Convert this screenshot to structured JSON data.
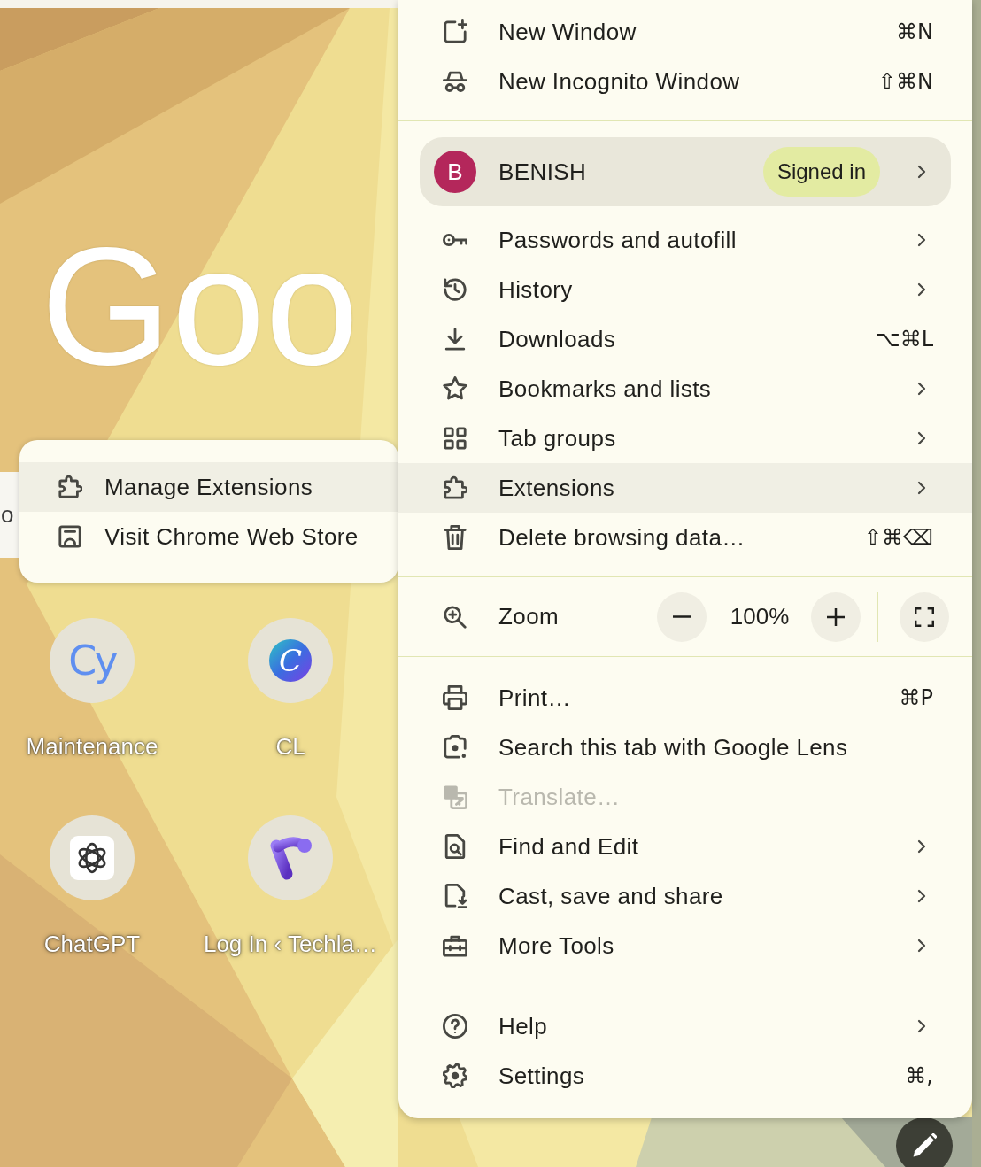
{
  "new_tab_page": {
    "logo_text": "Goo",
    "search_field": {
      "placeholder": "o"
    },
    "shortcuts": [
      {
        "kind": "letters",
        "icon_text": "Cy",
        "label": "Maintenance"
      },
      {
        "kind": "monogram",
        "icon_text": "C",
        "label": "CL"
      },
      {
        "kind": "knot",
        "label": "ChatGPT"
      },
      {
        "kind": "stroke",
        "label": "Log In ‹ Techla…"
      }
    ]
  },
  "extensions_submenu": {
    "items": [
      {
        "label": "Manage Extensions",
        "highlighted": true
      },
      {
        "label": "Visit Chrome Web Store",
        "highlighted": false
      }
    ]
  },
  "main_menu": {
    "sections": [
      {
        "items": [
          {
            "kind": "item",
            "label": "New Window",
            "shortcut": "⌘N",
            "submenu": false,
            "disabled": false,
            "highlighted": false
          },
          {
            "kind": "item",
            "label": "New Incognito Window",
            "shortcut": "⇧⌘N",
            "submenu": false,
            "disabled": false,
            "highlighted": false
          }
        ]
      },
      {
        "items": [
          {
            "kind": "profile",
            "avatar_letter": "B",
            "name": "BENISH",
            "status": "Signed in",
            "submenu": true
          },
          {
            "kind": "item",
            "label": "Passwords and autofill",
            "submenu": true,
            "disabled": false,
            "highlighted": false
          },
          {
            "kind": "item",
            "label": "History",
            "submenu": true,
            "disabled": false,
            "highlighted": false
          },
          {
            "kind": "item",
            "label": "Downloads",
            "shortcut": "⌥⌘L",
            "submenu": false,
            "disabled": false,
            "highlighted": false
          },
          {
            "kind": "item",
            "label": "Bookmarks and lists",
            "submenu": true,
            "disabled": false,
            "highlighted": false
          },
          {
            "kind": "item",
            "label": "Tab groups",
            "submenu": true,
            "disabled": false,
            "highlighted": false
          },
          {
            "kind": "item",
            "label": "Extensions",
            "submenu": true,
            "disabled": false,
            "highlighted": true
          },
          {
            "kind": "item",
            "label": "Delete browsing data…",
            "shortcut": "⇧⌘⌫",
            "submenu": false,
            "disabled": false,
            "highlighted": false
          }
        ]
      },
      {
        "items": [
          {
            "kind": "zoom",
            "label": "Zoom",
            "value": "100%"
          }
        ]
      },
      {
        "items": [
          {
            "kind": "item",
            "label": "Print…",
            "shortcut": "⌘P",
            "submenu": false,
            "disabled": false,
            "highlighted": false
          },
          {
            "kind": "item",
            "label": "Search this tab with Google Lens",
            "submenu": false,
            "disabled": false,
            "highlighted": false
          },
          {
            "kind": "item",
            "label": "Translate…",
            "submenu": false,
            "disabled": true,
            "highlighted": false
          },
          {
            "kind": "item",
            "label": "Find and Edit",
            "submenu": true,
            "disabled": false,
            "highlighted": false
          },
          {
            "kind": "item",
            "label": "Cast, save and share",
            "submenu": true,
            "disabled": false,
            "highlighted": false
          },
          {
            "kind": "item",
            "label": "More Tools",
            "submenu": true,
            "disabled": false,
            "highlighted": false
          }
        ]
      },
      {
        "items": [
          {
            "kind": "item",
            "label": "Help",
            "submenu": true,
            "disabled": false,
            "highlighted": false
          },
          {
            "kind": "item",
            "label": "Settings",
            "shortcut": "⌘,",
            "submenu": false,
            "disabled": false,
            "highlighted": false
          }
        ]
      }
    ]
  }
}
